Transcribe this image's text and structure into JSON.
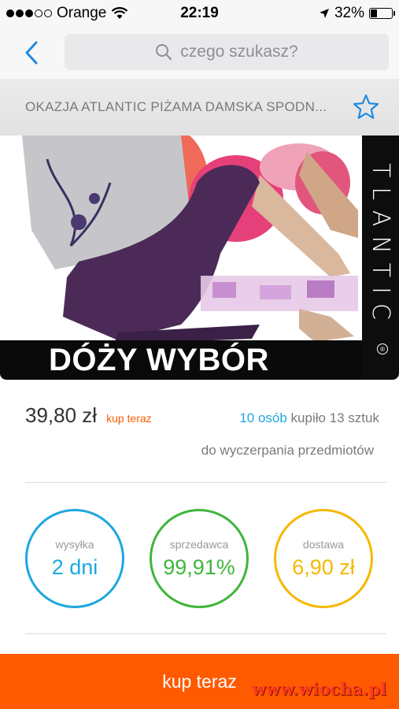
{
  "status_bar": {
    "carrier": "Orange",
    "time": "22:19",
    "battery_percent": "32%",
    "battery_level": 0.32,
    "signal_bars": 3,
    "signal_total": 5
  },
  "search": {
    "placeholder": "czego szukasz?"
  },
  "listing": {
    "title": "OKAZJA ATLANTIC PIŻAMA DAMSKA SPODN..."
  },
  "image": {
    "banner_text": "DÓŻY WYBÓR",
    "brand_text": "TLANTIC",
    "reg_mark": "®"
  },
  "price": {
    "amount": "39,80 zł",
    "buy_now_tag": "kup teraz",
    "buyers_count": "10 osób",
    "buyers_rest": " kupiło 13 sztuk",
    "stock": "do wyczerpania przedmiotów"
  },
  "stats": {
    "shipping": {
      "label": "wysyłka",
      "value": "2 dni"
    },
    "seller": {
      "label": "sprzedawca",
      "value": "99,91%"
    },
    "delivery": {
      "label": "dostawa",
      "value": "6,90 zł"
    }
  },
  "buy_button": {
    "label": "kup teraz"
  },
  "watermark": {
    "text": "www.wiocha.pl"
  },
  "colors": {
    "accent_orange": "#ff5a00",
    "ios_blue": "#1f8ae0",
    "stat_blue": "#1fa7df",
    "stat_green": "#3fb63b",
    "stat_yellow": "#f5b800"
  }
}
